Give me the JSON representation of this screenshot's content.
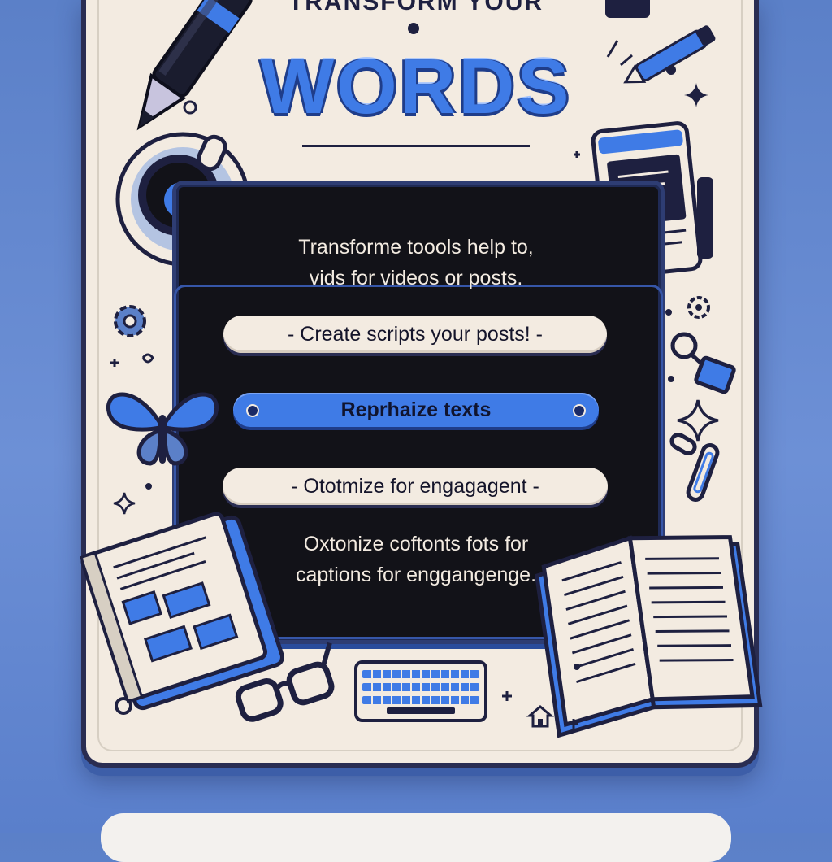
{
  "header": {
    "title_top": "TRANSFORM YOUR",
    "title_main": "WORDS"
  },
  "screen": {
    "intro_line1": "Transforme toools help to,",
    "intro_line2": "vids for videos or posts.",
    "options": [
      {
        "label": "- Create scripts your posts! -",
        "state": "default"
      },
      {
        "label": "Reprhaize texts",
        "state": "selected"
      },
      {
        "label": "- Ototmize for engagagent -",
        "state": "default"
      }
    ],
    "outro_line1": "Oxtonize coftonts fots for",
    "outro_line2": "captions for enggangenge."
  },
  "colors": {
    "accent_blue": "#3f7be6",
    "dark_navy": "#1e2040",
    "card_cream": "#f3ebe1",
    "page_bg": "#5b80c8"
  },
  "icons": [
    "pen-icon",
    "pencil-icon",
    "coffee-cup-icon",
    "tablet-icon",
    "gear-icon",
    "butterfly-icon",
    "binder-clip-icon",
    "paper-clip-icon",
    "notebook-icon",
    "glasses-icon",
    "keyboard-icon",
    "open-book-icon",
    "house-icon",
    "sparkle-icon"
  ]
}
